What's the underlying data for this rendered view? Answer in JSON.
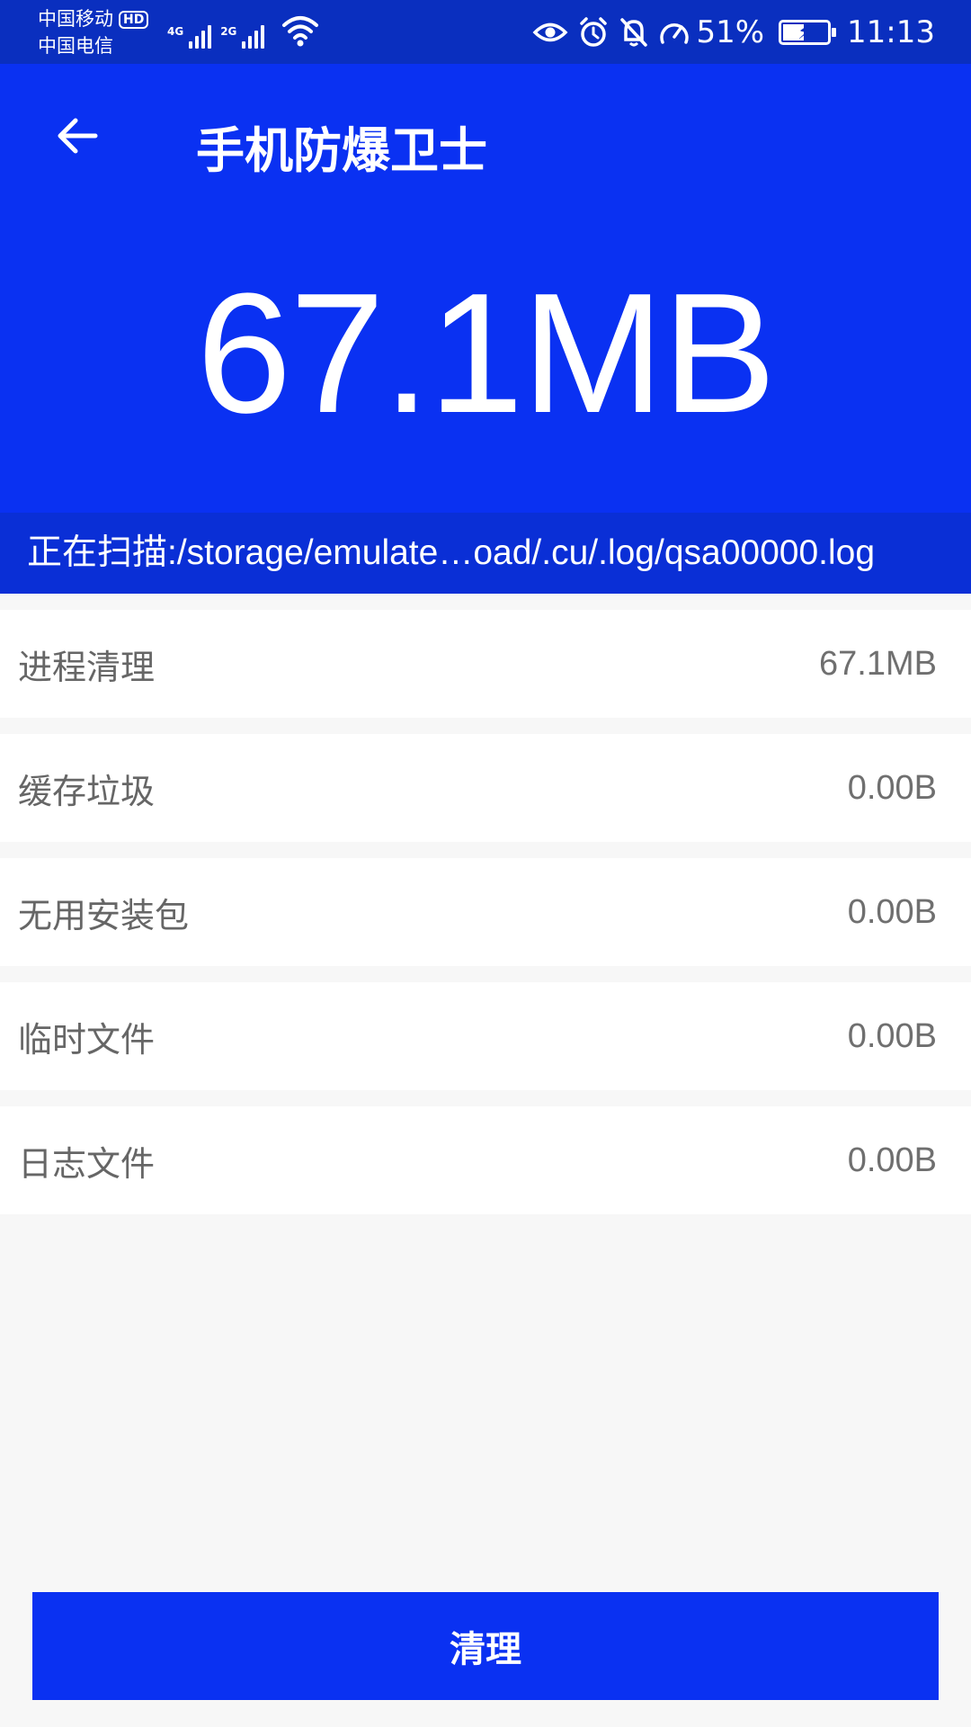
{
  "status_bar": {
    "carrier_1": "中国移动",
    "hd_badge": "HD",
    "carrier_2": "中国电信",
    "network_1": "4G",
    "network_2": "2G",
    "battery_percent": "51%",
    "battery_level": 0.51,
    "time": "11:13",
    "icons": [
      "eye-icon",
      "alarm-icon",
      "bell-off-icon",
      "speedometer-icon",
      "battery-charging-icon",
      "wifi-icon",
      "signal-icon"
    ]
  },
  "app_bar": {
    "title": "手机防爆卫士",
    "back_icon": "arrow-left-icon"
  },
  "hero": {
    "total_size": "67.1MB"
  },
  "scan": {
    "text": "正在扫描:/storage/emulate…oad/.cu/.log/qsa00000.log"
  },
  "items": [
    {
      "label": "进程清理",
      "value": "67.1MB"
    },
    {
      "label": "缓存垃圾",
      "value": "0.00B"
    },
    {
      "label": "无用安装包",
      "value": "0.00B"
    },
    {
      "label": "临时文件",
      "value": "0.00B"
    },
    {
      "label": "日志文件",
      "value": "0.00B"
    }
  ],
  "actions": {
    "clean_label": "清理"
  },
  "colors": {
    "primary": "#0a31f2",
    "status_bar": "#0a2fbf",
    "background": "#f7f7f7"
  }
}
